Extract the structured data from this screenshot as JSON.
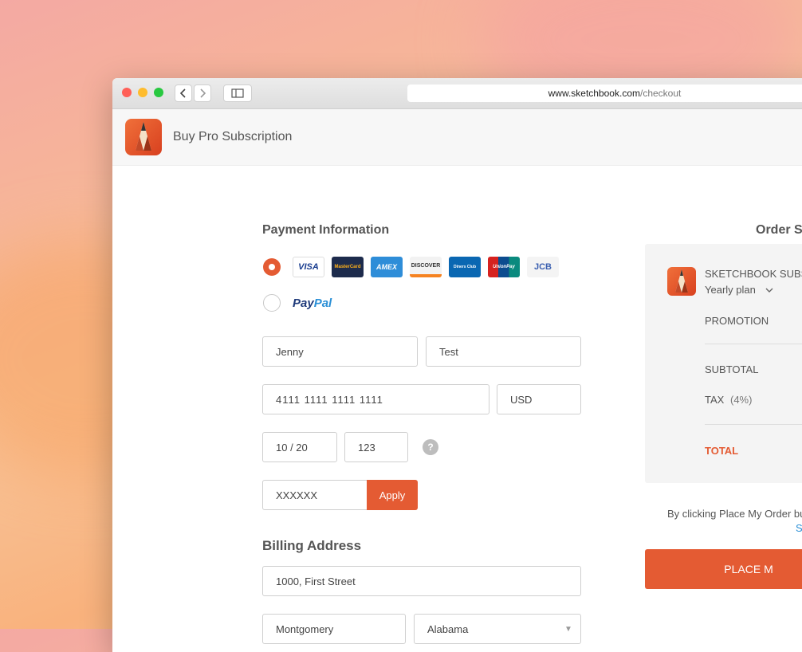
{
  "browser": {
    "url_domain": "www.sketchbook.com",
    "url_path": "/checkout"
  },
  "app": {
    "title": "Buy Pro Subscription"
  },
  "payment": {
    "heading": "Payment Information",
    "card_logos": [
      "VISA",
      "MasterCard",
      "AMEX",
      "DISCOVER",
      "Diners Club",
      "UnionPay",
      "JCB"
    ],
    "paypal_label_a": "Pay",
    "paypal_label_b": "Pal",
    "first_name": "Jenny",
    "last_name": "Test",
    "card_number": "4111  1111  1111  1111",
    "currency": "USD",
    "expiry": "10  /  20",
    "cvv": "123",
    "help_icon_text": "?",
    "promo_code": "XXXXXX",
    "apply_label": "Apply"
  },
  "billing": {
    "heading": "Billing Address",
    "address": "1000, First Street",
    "city": "Montgomery",
    "state": "Alabama"
  },
  "summary": {
    "heading": "Order S",
    "product": "SKETCHBOOK SUBS",
    "plan": "Yearly plan",
    "promotion_label": "PROMOTION",
    "subtotal_label": "SUBTOTAL",
    "tax_label": "TAX",
    "tax_rate": "(4%)",
    "total_label": "TOTAL",
    "notice": "By clicking Place My Order bu",
    "notice_link": "S",
    "place_order_label": "PLACE M"
  },
  "colors": {
    "accent": "#e45b33",
    "red_light": "#ff5f57",
    "yellow_light": "#febc2e",
    "green_light": "#28c840"
  }
}
